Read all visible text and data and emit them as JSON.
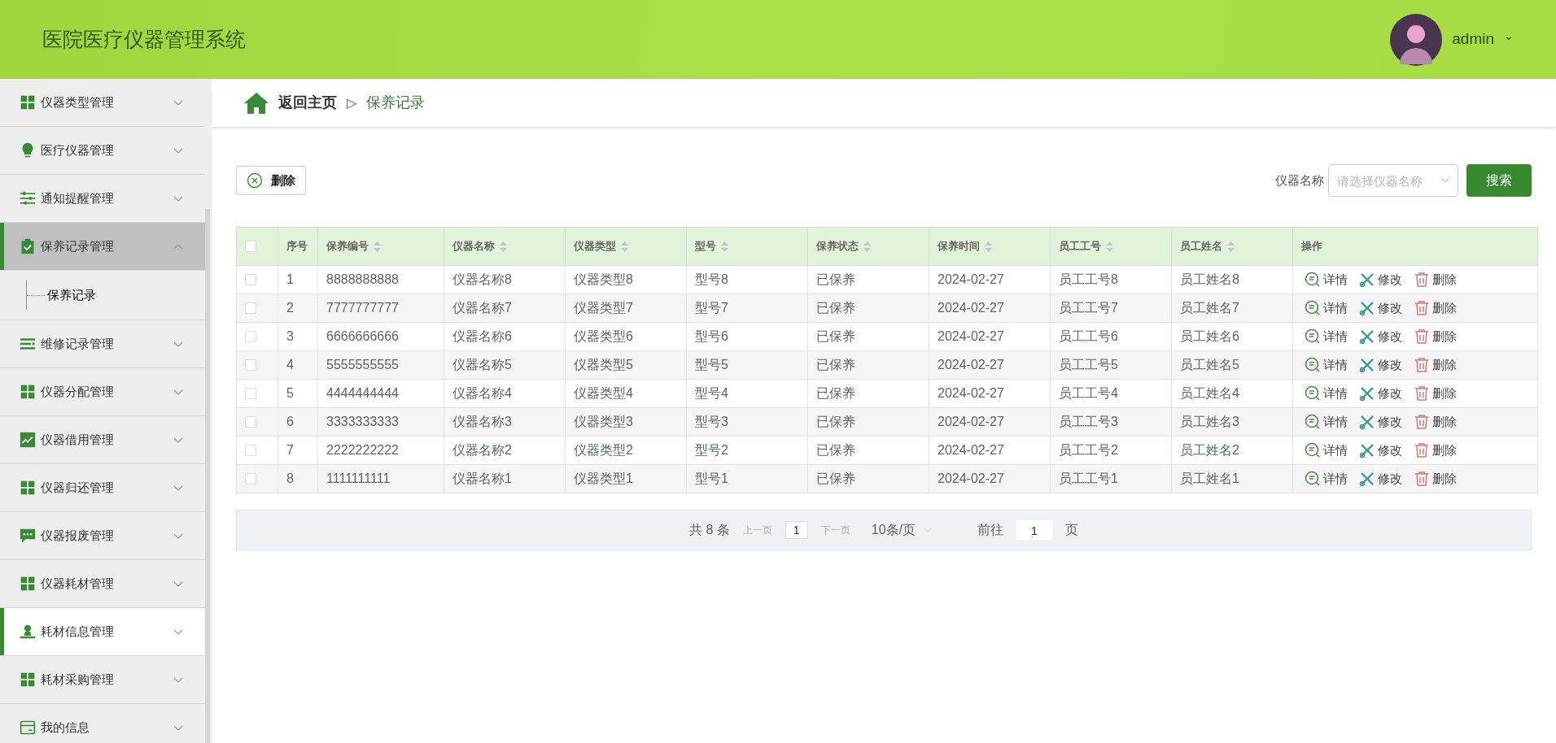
{
  "header": {
    "title": "医院医疗仪器管理系统",
    "user": {
      "name": "admin",
      "caret": "⌄"
    }
  },
  "sidebar": {
    "items": [
      {
        "label": "仪器类型管理",
        "kind": "grid",
        "selected": false,
        "hovered": false,
        "expanded": false
      },
      {
        "label": "医疗仪器管理",
        "kind": "bulb",
        "selected": false,
        "hovered": false,
        "expanded": false
      },
      {
        "label": "通知提醒管理",
        "kind": "sliders",
        "selected": false,
        "hovered": false,
        "expanded": false
      },
      {
        "label": "保养记录管理",
        "kind": "clipboard",
        "selected": true,
        "hovered": false,
        "expanded": true,
        "children": [
          {
            "label": "保养记录",
            "selected": true
          }
        ]
      },
      {
        "label": "维修记录管理",
        "kind": "list",
        "selected": false,
        "hovered": false,
        "expanded": false
      },
      {
        "label": "仪器分配管理",
        "kind": "grid",
        "selected": false,
        "hovered": false,
        "expanded": false
      },
      {
        "label": "仪器借用管理",
        "kind": "chart",
        "selected": false,
        "hovered": false,
        "expanded": false
      },
      {
        "label": "仪器归还管理",
        "kind": "grid",
        "selected": false,
        "hovered": false,
        "expanded": false
      },
      {
        "label": "仪器报废管理",
        "kind": "chat",
        "selected": false,
        "hovered": false,
        "expanded": false
      },
      {
        "label": "仪器耗材管理",
        "kind": "grid",
        "selected": false,
        "hovered": false,
        "expanded": false
      },
      {
        "label": "耗材信息管理",
        "kind": "user",
        "selected": false,
        "hovered": true,
        "expanded": false
      },
      {
        "label": "耗材采购管理",
        "kind": "grid",
        "selected": false,
        "hovered": false,
        "expanded": false
      },
      {
        "label": "我的信息",
        "kind": "card",
        "selected": false,
        "hovered": false,
        "expanded": false
      }
    ]
  },
  "breadcrumb": {
    "home": "返回主页",
    "separator": "▷",
    "current": "保养记录"
  },
  "toolbar": {
    "delete_button": "删除",
    "filter_label": "仪器名称",
    "filter": {
      "placeholder": "请选择仪器名称"
    },
    "search_button": "搜索"
  },
  "table": {
    "columns": [
      {
        "label": "序号",
        "sortable": false
      },
      {
        "label": "保养编号",
        "sortable": true
      },
      {
        "label": "仪器名称",
        "sortable": true
      },
      {
        "label": "仪器类型",
        "sortable": true
      },
      {
        "label": "型号",
        "sortable": true
      },
      {
        "label": "保养状态",
        "sortable": true
      },
      {
        "label": "保养时间",
        "sortable": true
      },
      {
        "label": "员工工号",
        "sortable": true
      },
      {
        "label": "员工姓名",
        "sortable": true
      },
      {
        "label": "操作",
        "sortable": false
      }
    ],
    "select_all": false,
    "rows": [
      {
        "checked": false,
        "cells": [
          "1",
          "8888888888",
          "仪器名称8",
          "仪器类型8",
          "型号8",
          "已保养",
          "2024-02-27",
          "员工工号8",
          "员工姓名8"
        ],
        "actions": [
          "详情",
          "修改",
          "删除"
        ]
      },
      {
        "checked": false,
        "cells": [
          "2",
          "7777777777",
          "仪器名称7",
          "仪器类型7",
          "型号7",
          "已保养",
          "2024-02-27",
          "员工工号7",
          "员工姓名7"
        ],
        "actions": [
          "详情",
          "修改",
          "删除"
        ]
      },
      {
        "checked": false,
        "cells": [
          "3",
          "6666666666",
          "仪器名称6",
          "仪器类型6",
          "型号6",
          "已保养",
          "2024-02-27",
          "员工工号6",
          "员工姓名6"
        ],
        "actions": [
          "详情",
          "修改",
          "删除"
        ]
      },
      {
        "checked": false,
        "cells": [
          "4",
          "5555555555",
          "仪器名称5",
          "仪器类型5",
          "型号5",
          "已保养",
          "2024-02-27",
          "员工工号5",
          "员工姓名5"
        ],
        "actions": [
          "详情",
          "修改",
          "删除"
        ]
      },
      {
        "checked": false,
        "cells": [
          "5",
          "4444444444",
          "仪器名称4",
          "仪器类型4",
          "型号4",
          "已保养",
          "2024-02-27",
          "员工工号4",
          "员工姓名4"
        ],
        "actions": [
          "详情",
          "修改",
          "删除"
        ]
      },
      {
        "checked": false,
        "cells": [
          "6",
          "3333333333",
          "仪器名称3",
          "仪器类型3",
          "型号3",
          "已保养",
          "2024-02-27",
          "员工工号3",
          "员工姓名3"
        ],
        "actions": [
          "详情",
          "修改",
          "删除"
        ]
      },
      {
        "checked": false,
        "cells": [
          "7",
          "2222222222",
          "仪器名称2",
          "仪器类型2",
          "型号2",
          "已保养",
          "2024-02-27",
          "员工工号2",
          "员工姓名2"
        ],
        "actions": [
          "详情",
          "修改",
          "删除"
        ]
      },
      {
        "checked": false,
        "cells": [
          "8",
          "1111111111",
          "仪器名称1",
          "仪器类型1",
          "型号1",
          "已保养",
          "2024-02-27",
          "员工工号1",
          "员工姓名1"
        ],
        "actions": [
          "详情",
          "修改",
          "删除"
        ]
      }
    ]
  },
  "pagination": {
    "total": "共 8 条",
    "prev": "上一页",
    "page": "1",
    "next": "下一页",
    "page_size": "10条/页",
    "goto_label": "前往",
    "goto_value": "1",
    "goto_suffix": "页"
  }
}
